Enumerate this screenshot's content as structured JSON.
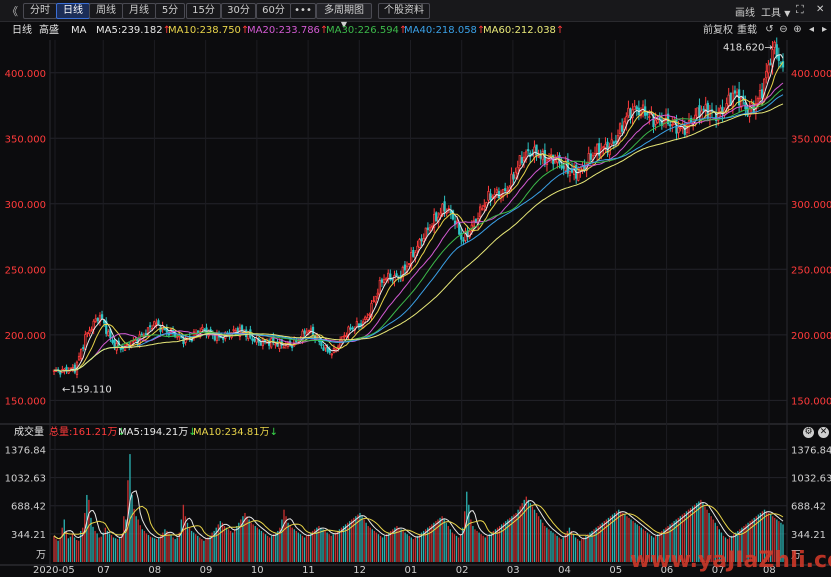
{
  "toolbar": {
    "back_glyph": "《",
    "periods": [
      "分时",
      "日线",
      "周线",
      "月线",
      "5分",
      "15分",
      "30分",
      "60分"
    ],
    "active_period": "日线",
    "more_label": "•••",
    "multi_label": "多周期图",
    "multi_arrow": "▼",
    "profile_label": "个股资料",
    "draw_label": "画线",
    "tools_label": "工具",
    "tools_arrow": "▼",
    "fullscreen_glyph": "⛶",
    "close_glyph": "✕"
  },
  "indicator_bar": {
    "period": "日线",
    "price_type": "高盛",
    "ma_label": "MA",
    "ma_items": [
      {
        "label": "MA5:239.182",
        "arrow": "↑",
        "color": "#e8e8e8"
      },
      {
        "label": "MA10:238.750",
        "arrow": "↑",
        "color": "#e8d44a"
      },
      {
        "label": "MA20:233.786",
        "arrow": "↑",
        "color": "#d25ad2"
      },
      {
        "label": "MA30:226.594",
        "arrow": "↑",
        "color": "#3cb94a"
      },
      {
        "label": "MA40:218.058",
        "arrow": "↑",
        "color": "#3aa0e6"
      },
      {
        "label": "MA60:212.038",
        "arrow": "↑",
        "color": "#e8e878"
      }
    ],
    "adjust_label": "前复权",
    "reload_label": "重载"
  },
  "colors": {
    "up": "#ff3b3b",
    "down": "#2ec4c4",
    "axis": "#ff3b3b",
    "grid": "#23232a"
  },
  "chart_data": {
    "type": "candlestick",
    "price_ticks": [
      "400.000",
      "350.000",
      "300.000",
      "250.000",
      "200.000",
      "150.000"
    ],
    "price_values": [
      400,
      350,
      300,
      250,
      200,
      150
    ],
    "ylim": [
      135,
      425
    ],
    "max_label": "418.620",
    "min_label": "159.110",
    "max_value": 418.62,
    "min_value": 159.11,
    "x_ticks": [
      "2020-05",
      "07",
      "08",
      "09",
      "10",
      "11",
      "12",
      "01",
      "02",
      "03",
      "04",
      "05",
      "06",
      "07",
      "08"
    ],
    "volume_title": "成交量",
    "volume_items": [
      {
        "label": "总量:161.21万",
        "arrow": "↓",
        "color": "#ff3b3b"
      },
      {
        "label": "MA5:194.21万",
        "arrow": "↓",
        "color": "#e8e8e8"
      },
      {
        "label": "MA10:234.81万",
        "arrow": "↓",
        "color": "#e8d44a"
      }
    ],
    "volume_ticks": [
      "1376.84",
      "1032.63",
      "688.42",
      "344.21"
    ],
    "volume_values": [
      1376.84,
      1032.63,
      688.42,
      344.21
    ],
    "volume_unit": "万",
    "volume_ylim": [
      0,
      1480
    ],
    "close_path": [
      [
        0,
        172
      ],
      [
        4,
        170
      ],
      [
        10,
        175
      ],
      [
        15,
        200
      ],
      [
        22,
        212
      ],
      [
        28,
        196
      ],
      [
        34,
        190
      ],
      [
        40,
        194
      ],
      [
        48,
        212
      ],
      [
        54,
        200
      ],
      [
        62,
        198
      ],
      [
        70,
        202
      ],
      [
        76,
        199
      ],
      [
        84,
        202
      ],
      [
        92,
        200
      ],
      [
        100,
        196
      ],
      [
        108,
        190
      ],
      [
        115,
        196
      ],
      [
        122,
        202
      ],
      [
        128,
        193
      ],
      [
        134,
        188
      ],
      [
        142,
        202
      ],
      [
        150,
        215
      ],
      [
        158,
        240
      ],
      [
        166,
        248
      ],
      [
        174,
        262
      ],
      [
        182,
        290
      ],
      [
        187,
        298
      ],
      [
        192,
        285
      ],
      [
        196,
        272
      ],
      [
        200,
        285
      ],
      [
        208,
        300
      ],
      [
        216,
        312
      ],
      [
        224,
        330
      ],
      [
        232,
        342
      ],
      [
        238,
        335
      ],
      [
        244,
        325
      ],
      [
        252,
        328
      ],
      [
        260,
        335
      ],
      [
        268,
        350
      ],
      [
        276,
        365
      ],
      [
        284,
        375
      ],
      [
        290,
        362
      ],
      [
        296,
        358
      ],
      [
        302,
        362
      ],
      [
        310,
        366
      ],
      [
        318,
        372
      ],
      [
        326,
        380
      ],
      [
        333,
        372
      ],
      [
        340,
        388
      ],
      [
        346,
        415
      ],
      [
        350,
        402
      ]
    ],
    "volume_series": [
      320,
      280,
      260,
      300,
      420,
      520,
      380,
      290,
      310,
      350,
      300,
      270,
      260,
      380,
      420,
      600,
      820,
      760,
      540,
      430,
      380,
      350,
      300,
      310,
      360,
      420,
      380,
      350,
      330,
      300,
      290,
      280,
      300,
      340,
      560,
      520,
      1000,
      1320,
      820,
      650,
      560,
      520,
      450,
      400,
      380,
      350,
      330,
      310,
      300,
      290,
      280,
      300,
      320,
      360,
      400,
      380,
      350,
      330,
      300,
      280,
      300,
      360,
      520,
      700,
      560,
      480,
      420,
      380,
      360,
      340,
      320,
      300,
      280,
      260,
      280,
      300,
      320,
      360,
      380,
      420,
      460,
      500,
      480,
      440,
      420,
      400,
      380,
      360,
      400,
      440,
      480,
      520,
      560,
      600,
      560,
      520,
      480,
      460,
      440,
      420,
      400,
      380,
      360,
      340,
      320,
      300,
      320,
      340,
      360,
      380,
      420,
      520,
      640,
      560,
      480,
      440,
      420,
      400,
      380,
      360,
      340,
      320,
      300,
      320,
      340,
      360,
      380,
      400,
      420,
      440,
      420,
      400,
      380,
      360,
      340,
      320,
      340,
      360,
      380,
      400,
      420,
      440,
      460,
      480,
      500,
      520,
      540,
      560,
      580,
      600,
      560,
      520,
      480,
      440,
      420,
      400,
      380,
      360,
      340,
      320,
      300,
      320,
      340,
      360,
      380,
      400,
      420,
      440,
      420,
      400,
      380,
      360,
      340,
      320,
      300,
      280,
      300,
      320,
      340,
      360,
      380,
      400,
      420,
      440,
      460,
      480,
      500,
      520,
      540,
      560,
      520,
      480,
      440,
      400,
      360,
      340,
      320,
      300,
      340,
      420,
      620,
      860,
      700,
      520,
      440,
      400,
      380,
      360,
      340,
      320,
      300,
      320,
      340,
      360,
      380,
      400,
      420,
      440,
      460,
      480,
      500,
      520,
      540,
      560,
      580,
      600,
      640,
      680,
      720,
      760,
      800,
      760,
      720,
      680,
      640,
      600,
      560,
      520,
      480,
      440,
      420,
      400,
      380,
      360,
      340,
      320,
      300,
      280,
      300,
      340,
      380,
      420,
      380,
      340,
      300,
      280,
      260,
      280,
      300,
      320,
      340,
      360,
      380,
      400,
      420,
      440,
      460,
      480,
      500,
      520,
      540,
      560,
      580,
      600,
      620,
      640,
      620,
      600,
      580,
      560,
      540,
      520,
      500,
      480,
      460,
      440,
      420,
      400,
      380,
      360,
      340,
      320,
      300,
      320,
      340,
      360,
      380,
      400,
      420,
      440,
      460,
      480,
      500,
      520,
      540,
      560,
      580,
      600,
      620,
      640,
      660,
      680,
      700,
      720,
      740,
      760,
      720,
      680,
      640,
      600,
      560,
      520,
      480,
      440,
      400,
      360,
      320,
      300,
      280,
      300,
      320,
      340,
      360,
      380,
      400,
      420,
      440,
      460,
      480,
      500,
      520,
      540,
      560,
      580,
      600,
      620,
      640,
      620,
      600,
      580,
      560,
      540,
      520,
      500,
      480,
      460
    ]
  },
  "watermark": "www.yaJIaZhIi.com"
}
